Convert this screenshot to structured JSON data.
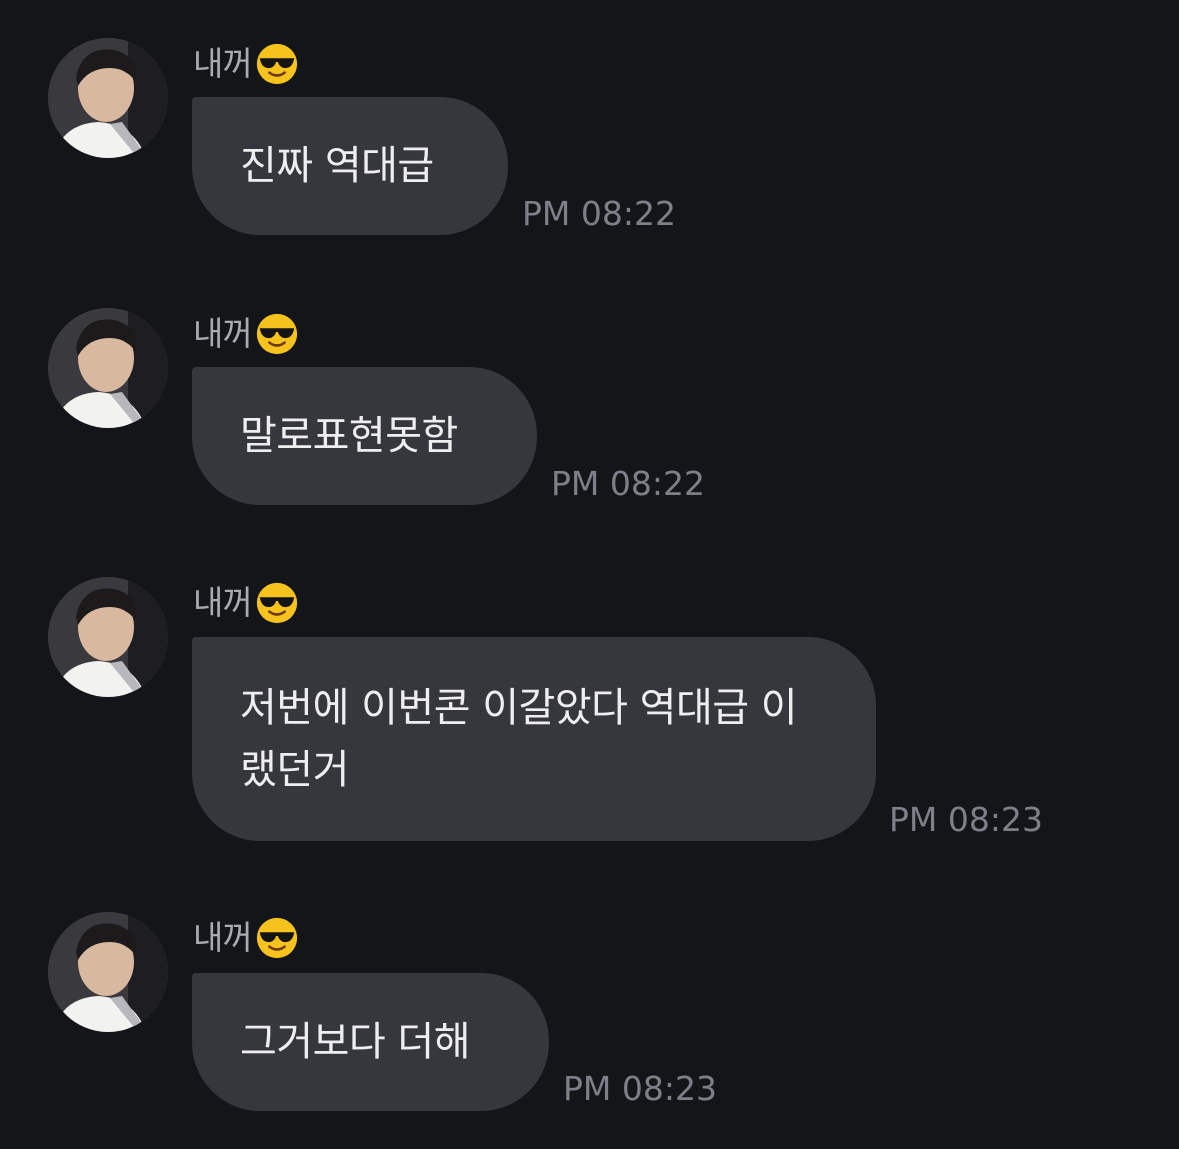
{
  "messages": [
    {
      "sender": "내꺼",
      "sender_emoji": "sunglasses-face-emoji",
      "text": "진짜 역대급",
      "time": "PM 08:22"
    },
    {
      "sender": "내꺼",
      "sender_emoji": "sunglasses-face-emoji",
      "text": "말로표현못함",
      "time": "PM 08:22"
    },
    {
      "sender": "내꺼",
      "sender_emoji": "sunglasses-face-emoji",
      "text": "저번에 이번콘 이갈았다 역대급 이랬던거",
      "time": "PM 08:23"
    },
    {
      "sender": "내꺼",
      "sender_emoji": "sunglasses-face-emoji",
      "text": "그거보다 더해",
      "time": "PM 08:23"
    }
  ],
  "colors": {
    "background": "#141519",
    "bubble": "#35373d",
    "message_text": "#eeeef0",
    "sender_text": "#a9abb1",
    "time_text": "#7d8088"
  }
}
